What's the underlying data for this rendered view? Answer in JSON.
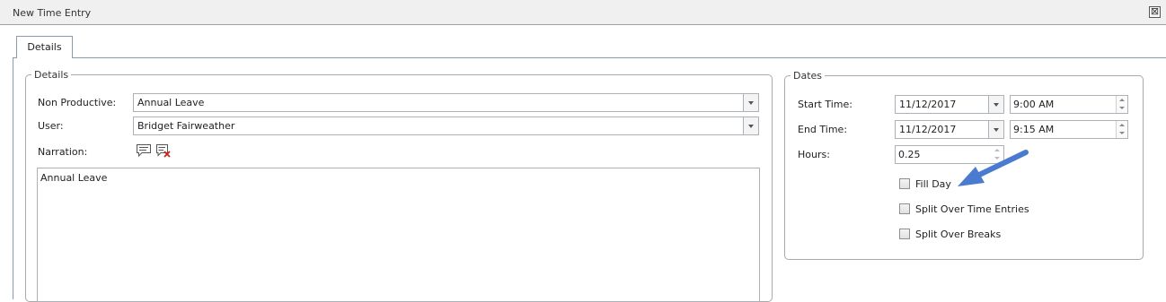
{
  "window": {
    "title": "New Time Entry",
    "close_glyph": "⊠"
  },
  "tabs": [
    {
      "label": "Details"
    }
  ],
  "details": {
    "legend": "Details",
    "non_productive": {
      "label": "Non Productive:",
      "value": "Annual Leave"
    },
    "user": {
      "label": "User:",
      "value": "Bridget Fairweather"
    },
    "narration": {
      "label": "Narration:",
      "text": "Annual Leave"
    }
  },
  "dates": {
    "legend": "Dates",
    "start": {
      "label": "Start Time:",
      "date": "11/12/2017",
      "time": "9:00 AM"
    },
    "end": {
      "label": "End Time:",
      "date": "11/12/2017",
      "time": "9:15 AM"
    },
    "hours": {
      "label": "Hours:",
      "value": "0.25"
    },
    "checkboxes": [
      {
        "label": "Fill Day",
        "checked": false
      },
      {
        "label": "Split Over Time Entries",
        "checked": false
      },
      {
        "label": "Split Over Breaks",
        "checked": false
      }
    ]
  },
  "colors": {
    "annotation_arrow": "#4a7bd0",
    "tab_border": "#8c9bab"
  }
}
